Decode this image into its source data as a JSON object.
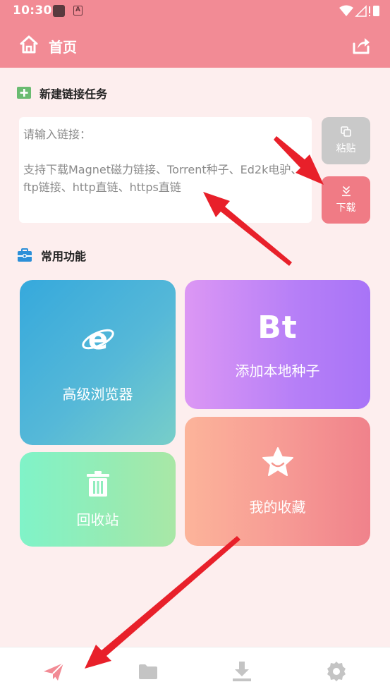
{
  "status_bar": {
    "time": "10:30",
    "indicator_letter": "A"
  },
  "app_bar": {
    "title": "首页"
  },
  "new_task": {
    "section_title": "新建链接任务",
    "placeholder": "请输入链接：\n\n支持下载Magnet磁力链接、Torrent种子、Ed2k电驴、\nftp链接、http直链、https直链",
    "paste_label": "粘贴",
    "download_label": "下载"
  },
  "common": {
    "section_title": "常用功能",
    "browser_label": "高级浏览器",
    "bt_mark": "Bt",
    "bt_label": "添加本地种子",
    "favorites_label": "我的收藏",
    "recycle_label": "回收站"
  },
  "colors": {
    "accent": "#f28b95",
    "background": "#fdeeee",
    "annotation_arrow": "#e8202a"
  }
}
